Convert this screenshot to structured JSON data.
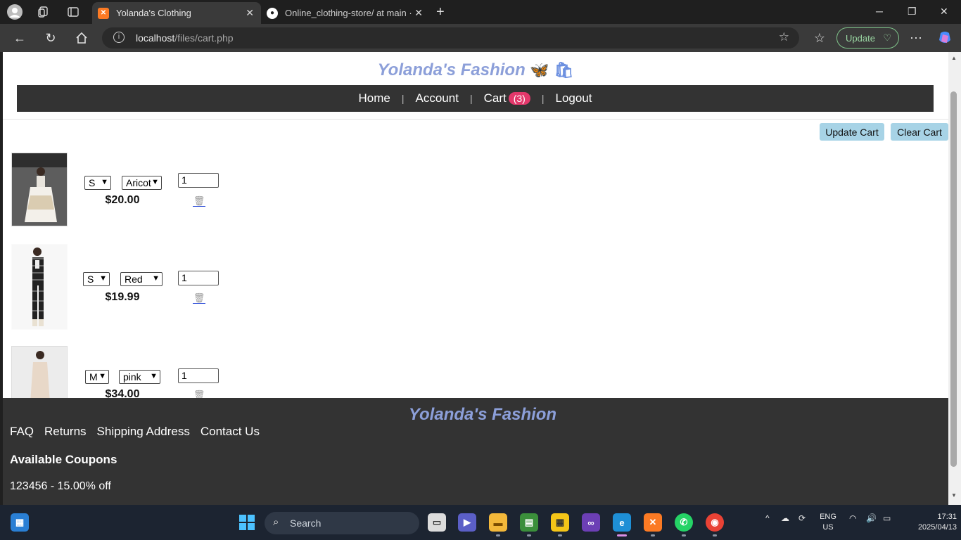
{
  "browser": {
    "tabs": [
      {
        "title": "Yolanda's Clothing",
        "active": true
      },
      {
        "title": "Online_clothing-store/ at main · Y",
        "active": false
      }
    ],
    "url_host": "localhost",
    "url_path": "/files/cart.php",
    "update_label": "Update"
  },
  "site": {
    "brand": "Yolanda's Fashion",
    "nav": [
      {
        "label": "Home"
      },
      {
        "label": "Account"
      },
      {
        "label": "Cart"
      },
      {
        "label": "Logout"
      }
    ],
    "cart_count": "(3)"
  },
  "cart": {
    "update_label": "Update Cart",
    "clear_label": "Clear Cart",
    "items": [
      {
        "size": "S",
        "color": "Aricot",
        "price": "$20.00",
        "qty": "1"
      },
      {
        "size": "S",
        "color": "Red",
        "price": "$19.99",
        "qty": "1"
      },
      {
        "size": "M",
        "color": "pink",
        "price": "$34.00",
        "qty": "1"
      }
    ]
  },
  "footer": {
    "brand": "Yolanda's Fashion",
    "links": [
      {
        "label": "FAQ"
      },
      {
        "label": "Returns"
      },
      {
        "label": "Shipping Address"
      },
      {
        "label": "Contact Us"
      }
    ],
    "coupons_title": "Available Coupons",
    "coupon_text": "123456 - 15.00% off"
  },
  "taskbar": {
    "search_label": "Search",
    "lang_top": "ENG",
    "lang_bottom": "US",
    "time": "17:31",
    "date": "2025/04/13"
  }
}
